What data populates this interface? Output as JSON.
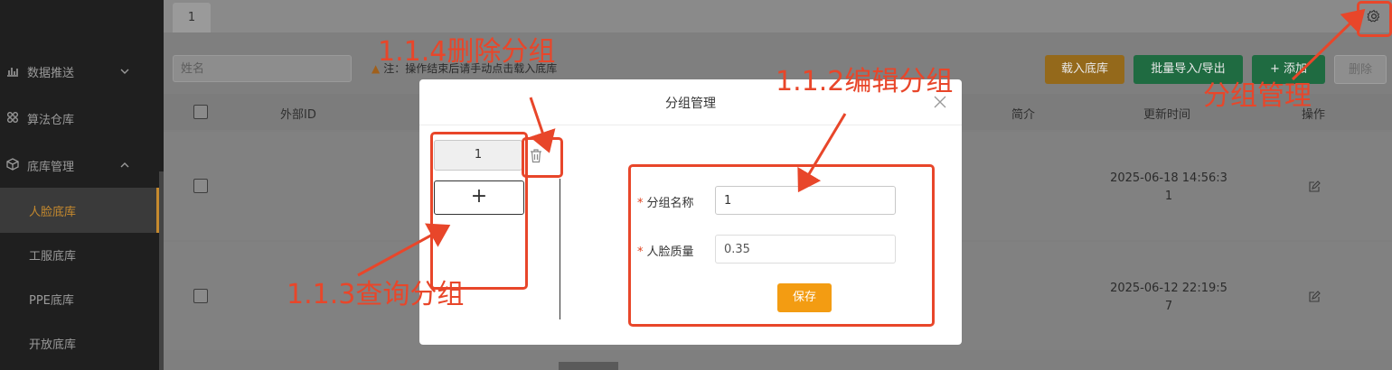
{
  "sidebar": {
    "items": [
      {
        "label": "数据推送",
        "icon": "chart-icon"
      },
      {
        "label": "算法仓库",
        "icon": "apps-icon"
      },
      {
        "label": "底库管理",
        "icon": "box-icon"
      }
    ],
    "subitems": [
      {
        "label": "人脸底库",
        "active": true
      },
      {
        "label": "工服底库",
        "active": false
      },
      {
        "label": "PPE底库",
        "active": false
      },
      {
        "label": "开放底库",
        "active": false
      }
    ]
  },
  "tabs": [
    {
      "label": "1"
    }
  ],
  "toolbar": {
    "search_placeholder": "姓名",
    "note": "注：操作结束后请手动点击载入底库",
    "load_label": "载入底库",
    "batch_label": "批量导入/导出",
    "add_label": "+ 添加",
    "delete_label": "删除"
  },
  "table": {
    "headers": {
      "external_id": "外部ID",
      "intro": "简介",
      "update_time": "更新时间",
      "action": "操作"
    },
    "rows": [
      {
        "time_line1": "2025-06-18 14:56:3",
        "time_line2": "1"
      },
      {
        "time_line1": "2025-06-12 22:19:5",
        "time_line2": "7"
      }
    ]
  },
  "modal": {
    "title": "分组管理",
    "groups": [
      {
        "label": "1"
      }
    ],
    "add_symbol": "+",
    "form": {
      "name_label": "分组名称",
      "name_value": "1",
      "quality_label": "人脸质量",
      "quality_value": "0.35",
      "required_mark": "*",
      "save_label": "保存"
    }
  },
  "annotations": {
    "group_manage": "分组管理",
    "edit_group": "1.1.2编辑分组",
    "query_group": "1.1.3查询分组",
    "delete_group": "1.1.4删除分组"
  },
  "colors": {
    "annotation": "#e8462a",
    "accent_orange": "#f39c12",
    "active_menu": "#c68a2e"
  }
}
